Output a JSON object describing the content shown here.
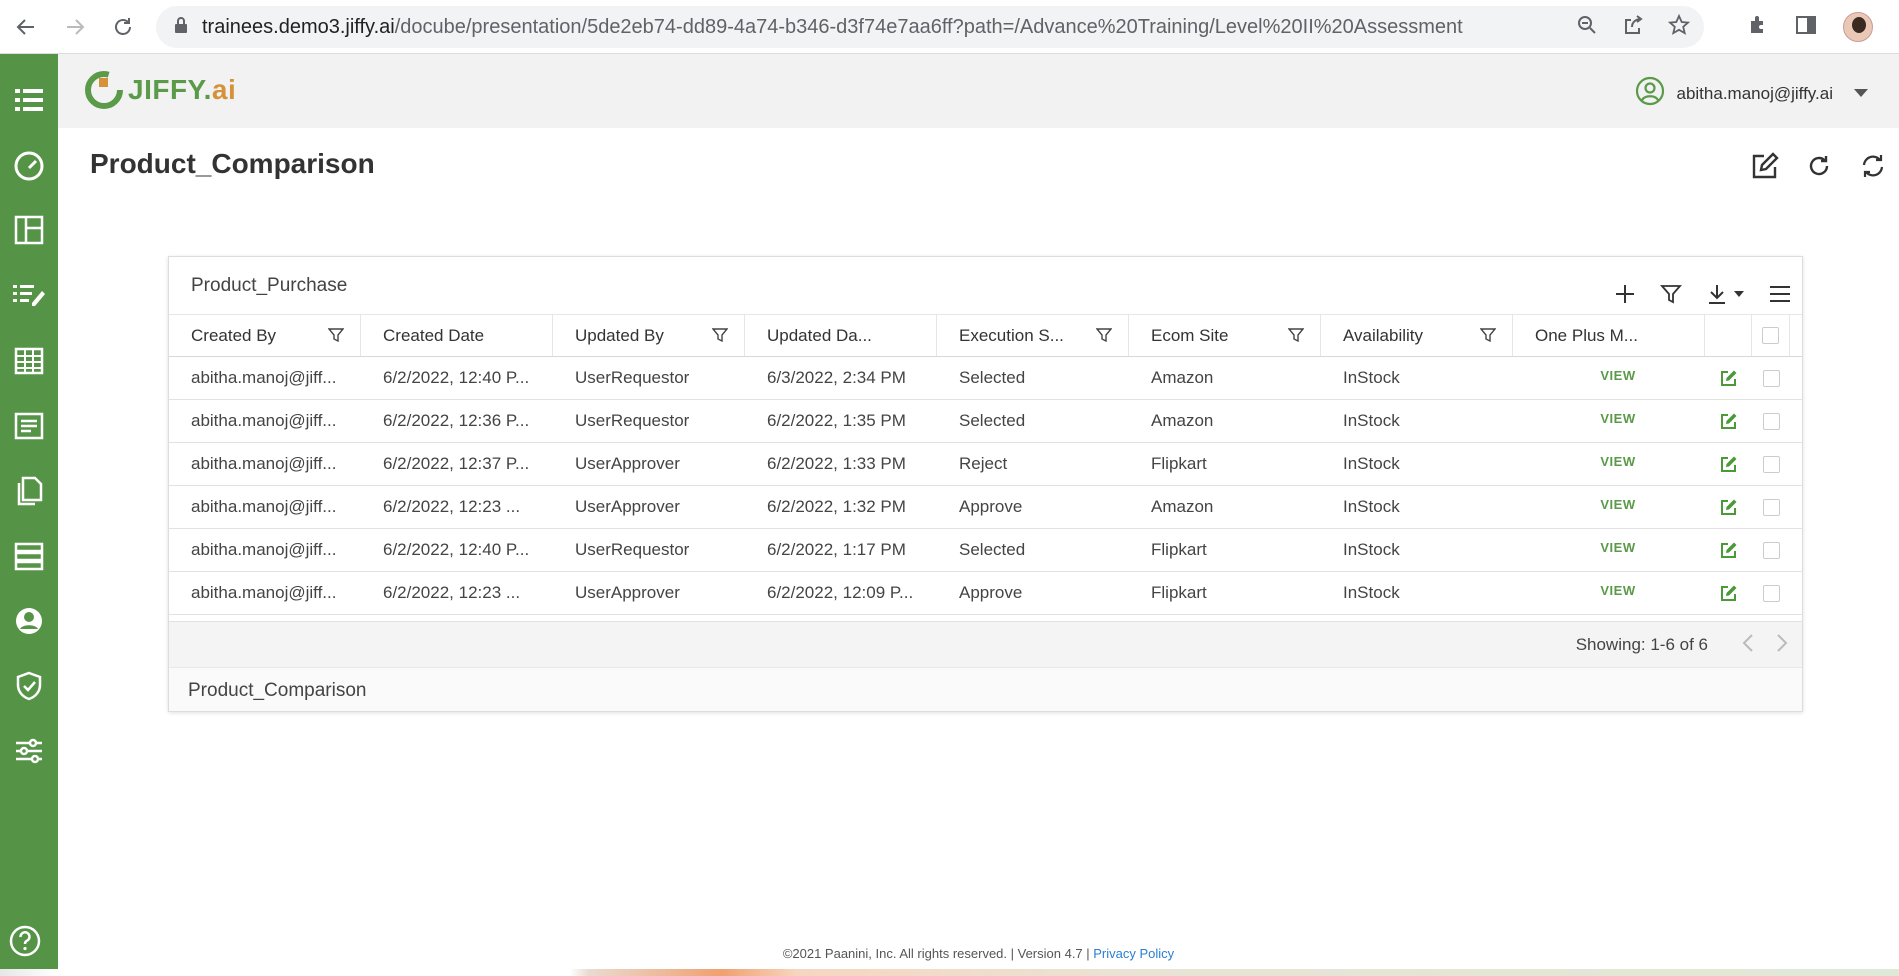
{
  "browser": {
    "url_host": "trainees.demo3.jiffy.ai",
    "url_path": "/docube/presentation/5de2eb74-dd89-4a74-b346-d3f74e7aa6ff?path=/Advance%20Training/Level%20II%20Assessment"
  },
  "header": {
    "logo_main": "JIFFY.",
    "logo_ai": "ai",
    "user_email": "abitha.manoj@jiffy.ai"
  },
  "page": {
    "title": "Product_Comparison"
  },
  "card": {
    "title": "Product_Purchase",
    "columns": [
      "Created By",
      "Created Date",
      "Updated By",
      "Updated Da...",
      "Execution S...",
      "Ecom Site",
      "Availability",
      "One Plus M..."
    ],
    "rows": [
      [
        "abitha.manoj@jiff...",
        "6/2/2022, 12:40 P...",
        "UserRequestor",
        "6/3/2022, 2:34 PM",
        "Selected",
        "Amazon",
        "InStock",
        "VIEW"
      ],
      [
        "abitha.manoj@jiff...",
        "6/2/2022, 12:36 P...",
        "UserRequestor",
        "6/2/2022, 1:35 PM",
        "Selected",
        "Amazon",
        "InStock",
        "VIEW"
      ],
      [
        "abitha.manoj@jiff...",
        "6/2/2022, 12:37 P...",
        "UserApprover",
        "6/2/2022, 1:33 PM",
        "Reject",
        "Flipkart",
        "InStock",
        "VIEW"
      ],
      [
        "abitha.manoj@jiff...",
        "6/2/2022, 12:23 ...",
        "UserApprover",
        "6/2/2022, 1:32 PM",
        "Approve",
        "Amazon",
        "InStock",
        "VIEW"
      ],
      [
        "abitha.manoj@jiff...",
        "6/2/2022, 12:40 P...",
        "UserRequestor",
        "6/2/2022, 1:17 PM",
        "Selected",
        "Flipkart",
        "InStock",
        "VIEW"
      ],
      [
        "abitha.manoj@jiff...",
        "6/2/2022, 12:23 ...",
        "UserApprover",
        "6/2/2022, 12:09 P...",
        "Approve",
        "Flipkart",
        "InStock",
        "VIEW"
      ]
    ],
    "showing": "Showing: 1-6 of 6",
    "bottom_title": "Product_Comparison"
  },
  "footer": {
    "copyright": "©2021 Paanini, Inc. All rights reserved. | Version 4.7 | ",
    "privacy": "Privacy Policy"
  },
  "colors": {
    "sidebar": "#559447",
    "accent_green": "#5a9a48",
    "logo_orange": "#d5923b",
    "link_blue": "#2a7fd4"
  },
  "icons": {
    "sidebar": [
      "list-icon",
      "dashboard-gauge-icon",
      "layout-icon",
      "edit-list-icon",
      "table-icon",
      "form-icon",
      "documents-icon",
      "database-icon",
      "user-icon",
      "shield-icon",
      "settings-sliders-icon"
    ],
    "help": "help-icon"
  }
}
